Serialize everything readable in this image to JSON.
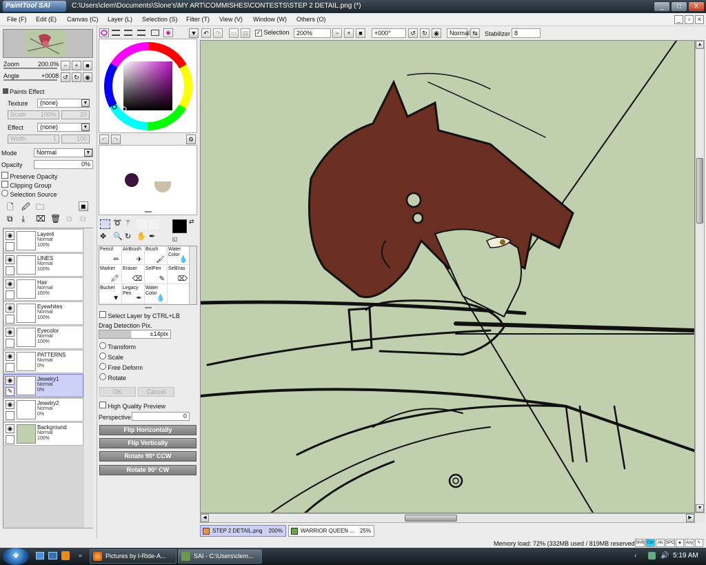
{
  "window": {
    "app_logo": "PaintTool SAI",
    "title": "C:\\Users\\clem\\Documents\\Slone's\\MY ART\\COMMISHES\\CONTESTS\\STEP 2 DETAIL.png (*)",
    "minimize": "_",
    "maximize": "□",
    "close": "X"
  },
  "menu": [
    "File (F)",
    "Edit (E)",
    "Canvas (C)",
    "Layer (L)",
    "Selection (S)",
    "Filter (T)",
    "View (V)",
    "Window (W)",
    "Others (O)"
  ],
  "toolbar": {
    "selection_label": "Selection",
    "zoom_value": "200%",
    "rotation_value": "+000°",
    "mode_value": "Normal",
    "stabilizer_label": "Stabilizer",
    "stabilizer_value": "8"
  },
  "navigator": {
    "zoom_label": "Zoom",
    "zoom_value": "200.0%",
    "angle_label": "Angle",
    "angle_value": "+0008"
  },
  "paint_effect": {
    "section_label": "Paints Effect",
    "texture_label": "Texture",
    "texture_value": "(none)",
    "scale_label": "Scale",
    "scale_value": "100%",
    "scale_num": "20",
    "effect_label": "Effect",
    "effect_value": "(none)",
    "width_label": "Width",
    "width_value": "1",
    "width_num": "100"
  },
  "layer_props": {
    "mode_label": "Mode",
    "mode_value": "Normal",
    "opacity_label": "Opacity",
    "opacity_value": "0%",
    "preserve_opacity": "Preserve Opacity",
    "clipping_group": "Clipping Group",
    "selection_source": "Selection Source"
  },
  "layers": [
    {
      "name": "Layer4",
      "mode": "Normal",
      "opacity": "100%",
      "selected": false
    },
    {
      "name": "LINES",
      "mode": "Normal",
      "opacity": "100%",
      "selected": false
    },
    {
      "name": "Hair",
      "mode": "Normal",
      "opacity": "100%",
      "selected": false
    },
    {
      "name": "Eyewhites",
      "mode": "Normal",
      "opacity": "100%",
      "selected": false
    },
    {
      "name": "Eyecolor",
      "mode": "Normal",
      "opacity": "100%",
      "selected": false
    },
    {
      "name": "PATTERNS",
      "mode": "Normal",
      "opacity": "0%",
      "selected": false
    },
    {
      "name": "Jewelry1",
      "mode": "Normal",
      "opacity": "0%",
      "selected": true
    },
    {
      "name": "Jewelry2",
      "mode": "Normal",
      "opacity": "0%",
      "selected": false
    },
    {
      "name": "Background",
      "mode": "Normal",
      "opacity": "100%",
      "selected": false
    }
  ],
  "colors": {
    "swatch_dark": "#3d1340",
    "swatch_beige": "#cdbfa8",
    "hue_selected": "#c010c8",
    "primary": "#000000",
    "secondary": "#ffffff",
    "canvas_bg": "#c0cfad",
    "hair": "#6b2f22",
    "selected_layer": "#cdd0f7"
  },
  "tools": [
    {
      "name": "Pencil",
      "icon": "pencil-icon"
    },
    {
      "name": "AirBrush",
      "icon": "airbrush-icon"
    },
    {
      "name": "Brush",
      "icon": "brush-icon"
    },
    {
      "name": "Water Color",
      "icon": "watercolor-icon"
    },
    {
      "name": "Marker",
      "icon": "marker-icon"
    },
    {
      "name": "Eraser",
      "icon": "eraser-icon"
    },
    {
      "name": "SelPen",
      "icon": "selpen-icon"
    },
    {
      "name": "SelEras",
      "icon": "seleras-icon"
    },
    {
      "name": "Bucket",
      "icon": "bucket-icon"
    },
    {
      "name": "Legacy Pen",
      "icon": "legacypen-icon"
    },
    {
      "name": "Water Color",
      "icon": "watercolor-icon"
    }
  ],
  "tool_options": {
    "select_by_ctrl": "Select Layer by CTRL+LB",
    "drag_detection_label": "Drag Detection Pix.",
    "drag_detection_value": "±14pix",
    "transform": "Transform",
    "scale": "Scale",
    "free_deform": "Free Deform",
    "rotate": "Rotate",
    "ok": "OK",
    "cancel": "Cancel",
    "high_quality_preview": "High Quality Preview",
    "perspective_label": "Perspective",
    "perspective_value": "0",
    "flip_h": "Flip Horizontally",
    "flip_v": "Flip Vertically",
    "rotate_ccw": "Rotate 90° CCW",
    "rotate_cw": "Rotate 90° CW"
  },
  "doc_tabs": [
    {
      "name": "STEP 2 DETAIL.png",
      "zoom": "200%",
      "active": true
    },
    {
      "name": "WARRIOR QUEEN ...",
      "zoom": "25%",
      "active": false
    }
  ],
  "status": {
    "memory": "Memory load: 72% (332MB used / 819MB reserved)",
    "keys": [
      "Shift",
      "Ctrl",
      "Alt",
      "SPC",
      "◈",
      "Any",
      "✎"
    ]
  },
  "taskbar": {
    "start": "❖",
    "items": [
      "Pictures by I-Ride-A...",
      "SAI - C:\\Users\\clem..."
    ],
    "clock": "5:19 AM"
  }
}
